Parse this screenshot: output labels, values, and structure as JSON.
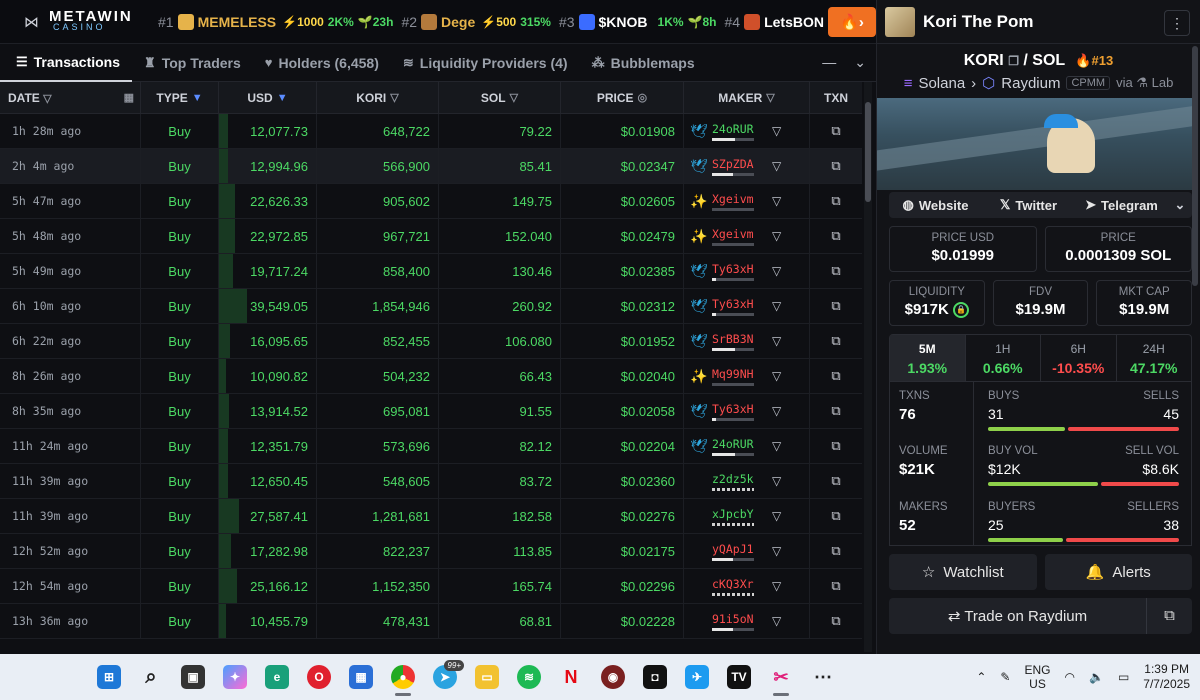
{
  "topbar": {
    "logo_title": "METAWIN",
    "logo_sub": "CASINO",
    "tickers": [
      {
        "rank": "#1",
        "symbol": "MEMELESS",
        "stat": "⚡1000",
        "pct": "2K%",
        "extra": "🌱23h",
        "color": "#e6b34a"
      },
      {
        "rank": "#2",
        "symbol": "Dege",
        "stat": "⚡500",
        "pct": "315%",
        "extra": "",
        "color": "#e6b34a"
      },
      {
        "rank": "#3",
        "symbol": "$KNOB",
        "stat": "1K%",
        "pct": "",
        "extra": "🌱8h",
        "color": "#ffffff"
      },
      {
        "rank": "#4",
        "symbol": "LetsBON",
        "stat": "",
        "pct": "",
        "extra": "",
        "color": "#ffffff"
      }
    ]
  },
  "tabs": [
    {
      "label": "Transactions",
      "icon": "list-icon",
      "glyph": "☰"
    },
    {
      "label": "Top Traders",
      "icon": "trophy-icon",
      "glyph": "♜"
    },
    {
      "label": "Holders (6,458)",
      "icon": "heart-icon",
      "glyph": "♥"
    },
    {
      "label": "Liquidity Providers (4)",
      "icon": "water-icon",
      "glyph": "≋"
    },
    {
      "label": "Bubblemaps",
      "icon": "bubbles-icon",
      "glyph": "⁂"
    }
  ],
  "columns": {
    "date": "DATE",
    "type": "TYPE",
    "usd": "USD",
    "kori": "KORI",
    "sol": "SOL",
    "price": "PRICE",
    "maker": "MAKER",
    "txn": "TXN"
  },
  "rows": [
    {
      "date": "1h 28m ago",
      "type": "Buy",
      "usd": "12,077.73",
      "usd_share": 0.31,
      "kori": "648,722",
      "sol": "79.22",
      "price": "$0.01908",
      "maker": "24oRUR",
      "maker_color": "#4cd964",
      "maker_fill": 0.55,
      "maker_tag": "bird"
    },
    {
      "date": "2h 4m ago",
      "type": "Buy",
      "usd": "12,994.96",
      "usd_share": 0.33,
      "kori": "566,900",
      "sol": "85.41",
      "price": "$0.02347",
      "maker": "SZpZDA",
      "maker_color": "#ff4d4d",
      "maker_fill": 0.5,
      "maker_tag": "bird"
    },
    {
      "date": "5h 47m ago",
      "type": "Buy",
      "usd": "22,626.33",
      "usd_share": 0.57,
      "kori": "905,602",
      "sol": "149.75",
      "price": "$0.02605",
      "maker": "Xgeivm",
      "maker_color": "#ff4d4d",
      "maker_fill": 0,
      "maker_tag": "sparkle"
    },
    {
      "date": "5h 48m ago",
      "type": "Buy",
      "usd": "22,972.85",
      "usd_share": 0.58,
      "kori": "967,721",
      "sol": "152.040",
      "price": "$0.02479",
      "maker": "Xgeivm",
      "maker_color": "#ff4d4d",
      "maker_fill": 0,
      "maker_tag": "sparkle"
    },
    {
      "date": "5h 49m ago",
      "type": "Buy",
      "usd": "19,717.24",
      "usd_share": 0.5,
      "kori": "858,400",
      "sol": "130.46",
      "price": "$0.02385",
      "maker": "Ty63xH",
      "maker_color": "#ff4d4d",
      "maker_fill": 0.1,
      "maker_tag": "bird"
    },
    {
      "date": "6h 10m ago",
      "type": "Buy",
      "usd": "39,549.05",
      "usd_share": 1.0,
      "kori": "1,854,946",
      "sol": "260.92",
      "price": "$0.02312",
      "maker": "Ty63xH",
      "maker_color": "#ff4d4d",
      "maker_fill": 0.1,
      "maker_tag": "bird"
    },
    {
      "date": "6h 22m ago",
      "type": "Buy",
      "usd": "16,095.65",
      "usd_share": 0.41,
      "kori": "852,455",
      "sol": "106.080",
      "price": "$0.01952",
      "maker": "SrBB3N",
      "maker_color": "#ff4d4d",
      "maker_fill": 0.55,
      "maker_tag": "bird"
    },
    {
      "date": "8h 26m ago",
      "type": "Buy",
      "usd": "10,090.82",
      "usd_share": 0.26,
      "kori": "504,232",
      "sol": "66.43",
      "price": "$0.02040",
      "maker": "Mq99NH",
      "maker_color": "#ff4d4d",
      "maker_fill": 0,
      "maker_tag": "sparkle"
    },
    {
      "date": "8h 35m ago",
      "type": "Buy",
      "usd": "13,914.52",
      "usd_share": 0.35,
      "kori": "695,081",
      "sol": "91.55",
      "price": "$0.02058",
      "maker": "Ty63xH",
      "maker_color": "#ff4d4d",
      "maker_fill": 0.1,
      "maker_tag": "bird"
    },
    {
      "date": "11h 24m ago",
      "type": "Buy",
      "usd": "12,351.79",
      "usd_share": 0.31,
      "kori": "573,696",
      "sol": "82.12",
      "price": "$0.02204",
      "maker": "24oRUR",
      "maker_color": "#4cd964",
      "maker_fill": 0.55,
      "maker_tag": "bird"
    },
    {
      "date": "11h 39m ago",
      "type": "Buy",
      "usd": "12,650.45",
      "usd_share": 0.32,
      "kori": "548,605",
      "sol": "83.72",
      "price": "$0.02360",
      "maker": "z2dz5k",
      "maker_color": "#4cd964",
      "maker_fill": 1,
      "maker_tag": "none"
    },
    {
      "date": "11h 39m ago",
      "type": "Buy",
      "usd": "27,587.41",
      "usd_share": 0.7,
      "kori": "1,281,681",
      "sol": "182.58",
      "price": "$0.02276",
      "maker": "xJpcbY",
      "maker_color": "#4cd964",
      "maker_fill": 1,
      "maker_tag": "none"
    },
    {
      "date": "12h 52m ago",
      "type": "Buy",
      "usd": "17,282.98",
      "usd_share": 0.44,
      "kori": "822,237",
      "sol": "113.85",
      "price": "$0.02175",
      "maker": "yQApJ1",
      "maker_color": "#ff4d4d",
      "maker_fill": 0.5,
      "maker_tag": "none"
    },
    {
      "date": "12h 54m ago",
      "type": "Buy",
      "usd": "25,166.12",
      "usd_share": 0.64,
      "kori": "1,152,350",
      "sol": "165.74",
      "price": "$0.02296",
      "maker": "cKQ3Xr",
      "maker_color": "#ff4d4d",
      "maker_fill": 1,
      "maker_tag": "none"
    },
    {
      "date": "13h 36m ago",
      "type": "Buy",
      "usd": "10,455.79",
      "usd_share": 0.26,
      "kori": "478,431",
      "sol": "68.81",
      "price": "$0.02228",
      "maker": "91i5oN",
      "maker_color": "#ff4d4d",
      "maker_fill": 0.5,
      "maker_tag": "none"
    }
  ],
  "panel": {
    "name": "Kori The Pom",
    "base": "KORI",
    "quote": "SOL",
    "rank": "#13",
    "chain": "Solana",
    "dex": "Raydium",
    "dex_tag": "CPMM",
    "via_word": "via",
    "via": "Lab",
    "links": [
      "Website",
      "Twitter",
      "Telegram"
    ],
    "price_usd_label": "PRICE USD",
    "price_usd": "$0.01999",
    "price_label": "PRICE",
    "price": "0.0001309 SOL",
    "liquidity_label": "LIQUIDITY",
    "liquidity": "$917K",
    "fdv_label": "FDV",
    "fdv": "$19.9M",
    "mcap_label": "MKT CAP",
    "mcap": "$19.9M",
    "timeframes": [
      {
        "label": "5M",
        "value": "1.93%",
        "dir": "up"
      },
      {
        "label": "1H",
        "value": "0.66%",
        "dir": "up"
      },
      {
        "label": "6H",
        "value": "-10.35%",
        "dir": "down"
      },
      {
        "label": "24H",
        "value": "47.17%",
        "dir": "up"
      }
    ],
    "txns_label": "TXNS",
    "txns": "76",
    "buys_label": "BUYS",
    "buys": "31",
    "sells_label": "SELLS",
    "sells": "45",
    "volume_label": "VOLUME",
    "volume": "$21K",
    "buyvol_label": "BUY VOL",
    "buyvol": "$12K",
    "sellvol_label": "SELL VOL",
    "sellvol": "$8.6K",
    "makers_label": "MAKERS",
    "makers": "52",
    "buyers_label": "BUYERS",
    "buyers": "25",
    "sellers_label": "SELLERS",
    "sellers": "38",
    "buys_share": 0.408,
    "buyvol_share": 0.583,
    "buyers_share": 0.397,
    "watchlist": "Watchlist",
    "alerts": "Alerts",
    "trade": "Trade on Raydium"
  },
  "taskbar": {
    "lang": "ENG",
    "region": "US",
    "time": "1:39 PM",
    "date": "7/7/2025",
    "telegram_badge": "99+"
  },
  "colors": {
    "accent_green": "#4cd964",
    "accent_red": "#ff4d4d",
    "fire": "#f07022"
  }
}
